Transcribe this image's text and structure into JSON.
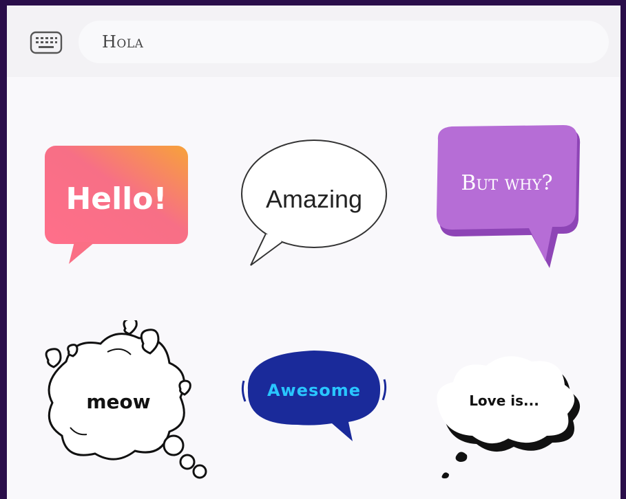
{
  "search": {
    "value": "Hola"
  },
  "icons": {
    "keyboard": "keyboard-icon"
  },
  "stickers": [
    {
      "text": "Hello!",
      "style": "gradient-rect",
      "colors": [
        "#ff6f8a",
        "#f7a23a"
      ]
    },
    {
      "text": "Amazing",
      "style": "white-oval"
    },
    {
      "text": "But why?",
      "style": "purple-rect",
      "colors": [
        "#b66dd6",
        "#8e45b6"
      ]
    },
    {
      "text": "meow",
      "style": "cloud-hearts"
    },
    {
      "text": "Awesome",
      "style": "navy-oval",
      "colors": [
        "#1a2a9a",
        "#29c6ff"
      ]
    },
    {
      "text": "Love is...",
      "style": "thought-cloud"
    }
  ]
}
